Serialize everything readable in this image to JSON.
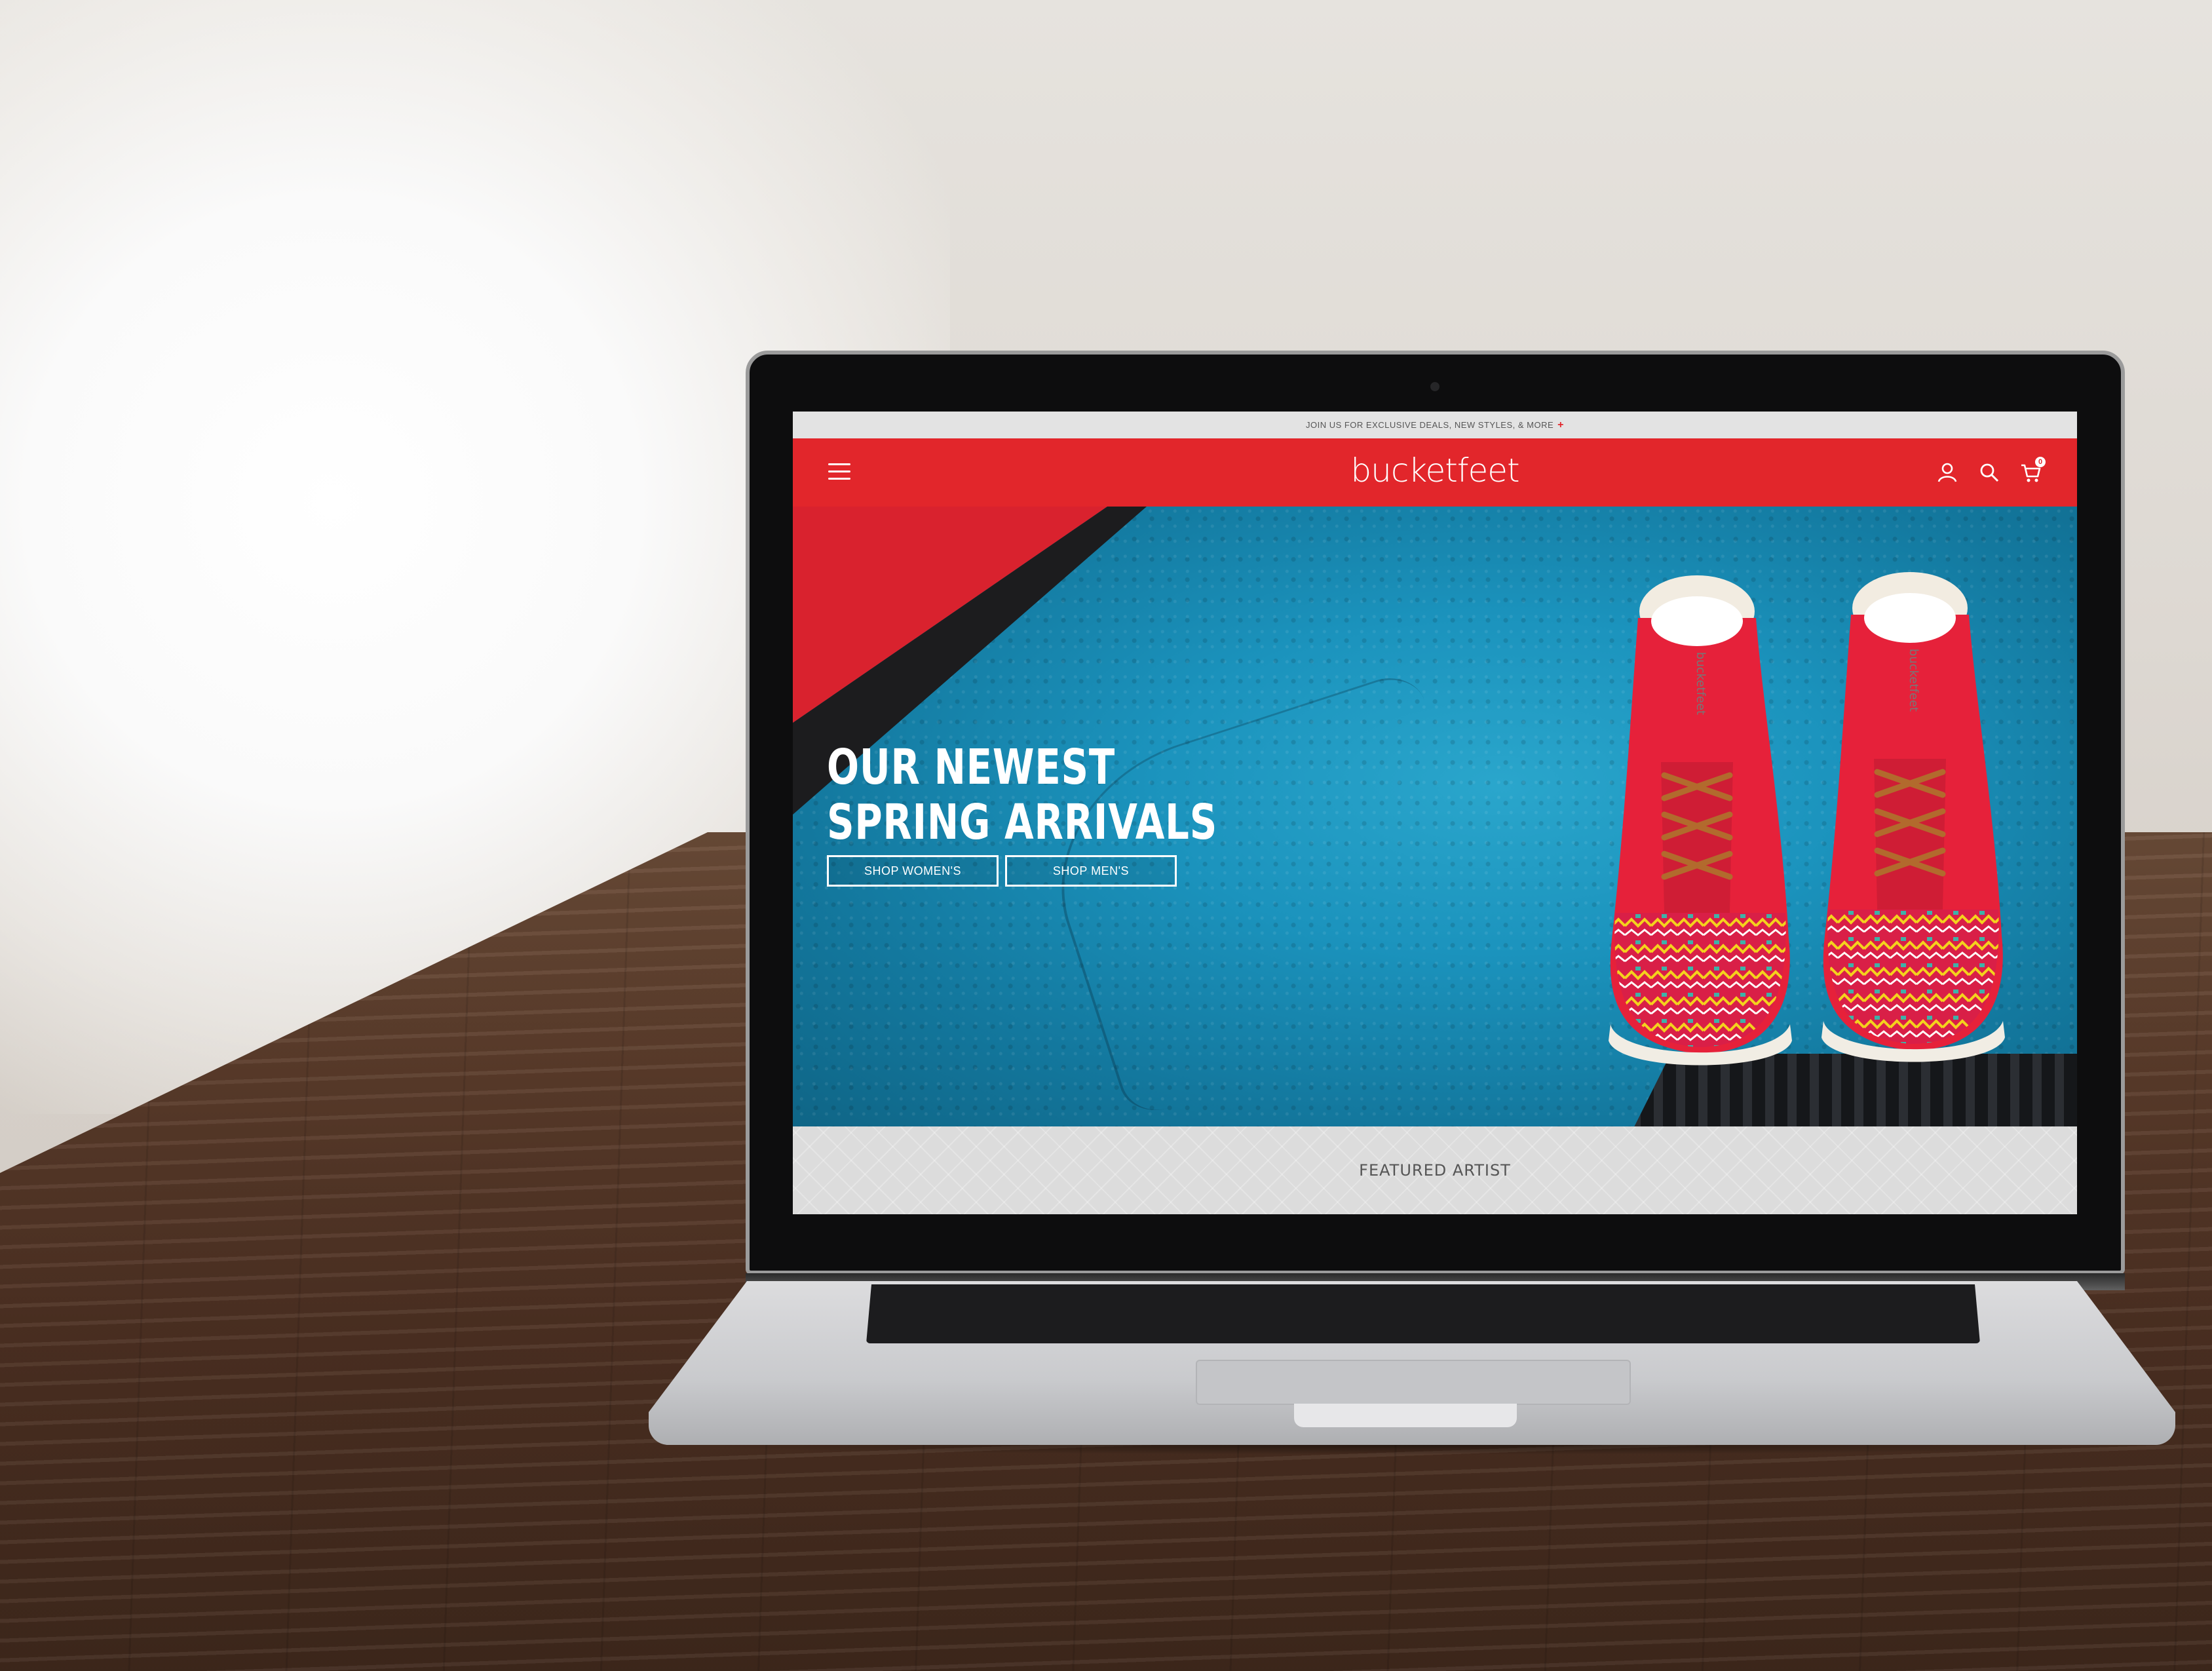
{
  "site": {
    "promo_bar": {
      "text": "JOIN US FOR EXCLUSIVE DEALS, NEW STYLES, & MORE",
      "plus_icon": "+"
    },
    "header": {
      "logo": "bucketfeet",
      "menu_icon": "hamburger-icon",
      "account_icon": "user-icon",
      "search_icon": "search-icon",
      "cart_icon": "cart-icon",
      "cart_count": "0"
    },
    "hero": {
      "title_line1": "OUR NEWEST",
      "title_line2": "SPRING ARRIVALS",
      "button_women": "SHOP WOMEN'S",
      "button_men": "SHOP MEN'S"
    },
    "featured_section": {
      "title": "FEATURED ARTIST"
    }
  },
  "colors": {
    "brand_red": "#e2262b",
    "promo_bg": "#e3e3e3",
    "hero_wall_blue": "#1b93bd",
    "featured_bg": "#dcdcdc"
  }
}
